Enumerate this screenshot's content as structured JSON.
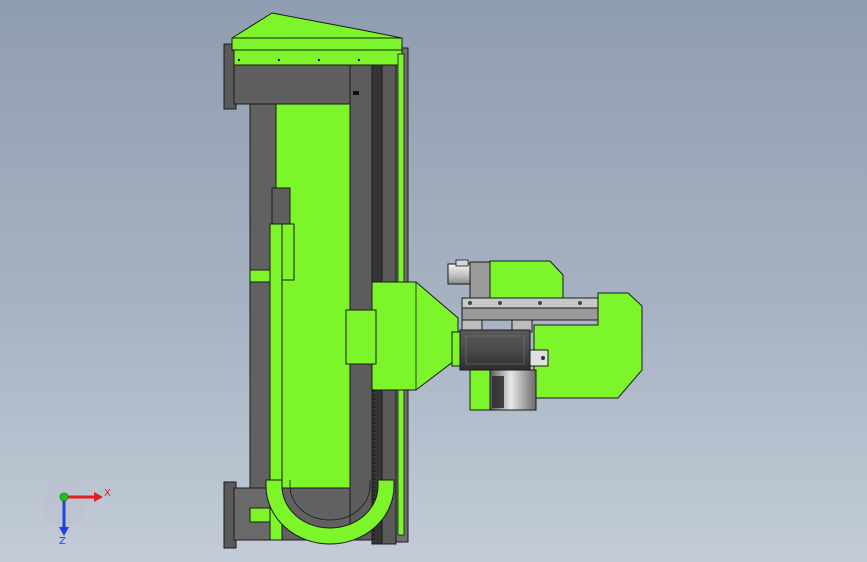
{
  "colors": {
    "background_top": "#8f9db0",
    "background_bottom": "#c3ccd8",
    "part_green": "#7cf52a",
    "part_gray": "#616161",
    "outline": "#1a1a1a",
    "motor_dark": "#3f3f3f",
    "axis_x": "#e02020",
    "axis_y": "#22c022",
    "axis_z": "#2040e0"
  },
  "triad": {
    "x_label": "X",
    "z_label": "Z"
  }
}
